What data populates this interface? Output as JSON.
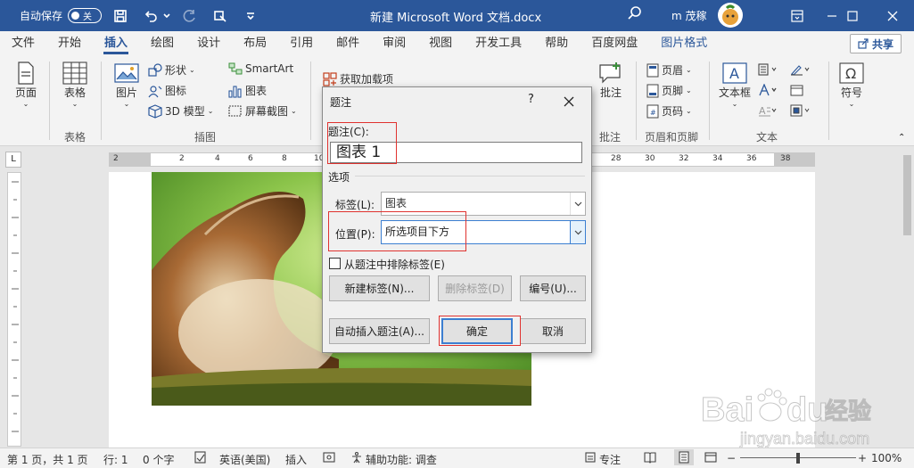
{
  "titlebar": {
    "autosave_label": "自动保存",
    "autosave_state": "关",
    "doc_title": "新建 Microsoft Word 文档.docx",
    "user_name": "m 茂稼"
  },
  "tabs": [
    "文件",
    "开始",
    "插入",
    "绘图",
    "设计",
    "布局",
    "引用",
    "邮件",
    "审阅",
    "视图",
    "开发工具",
    "帮助",
    "百度网盘",
    "图片格式"
  ],
  "share_label": "共享",
  "ribbon": {
    "page": "页面",
    "table": "表格",
    "table_group": "表格",
    "picture": "图片",
    "shapes": "形状",
    "icons": "图标",
    "model3d": "3D 模型",
    "smartart": "SmartArt",
    "chart": "图表",
    "screenshot": "屏幕截图",
    "illustrations_group": "插图",
    "addins": "获取加载项",
    "comment": "批注",
    "comment_group": "批注",
    "header": "页眉",
    "footer": "页脚",
    "page_number": "页码",
    "header_footer_group": "页眉和页脚",
    "textbox": "文本框",
    "text_group": "文本",
    "symbol": "符号"
  },
  "ruler": {
    "h_numbers": [
      "2",
      "2",
      "4",
      "6",
      "8",
      "10",
      "28",
      "30",
      "32",
      "34",
      "36",
      "38"
    ]
  },
  "dialog": {
    "title": "题注",
    "help": "?",
    "caption_label": "题注(C):",
    "caption_value": "图表 1",
    "options_label": "选项",
    "label_label": "标签(L):",
    "label_value": "图表",
    "position_label": "位置(P):",
    "position_value": "所选项目下方",
    "exclude_label": "从题注中排除标签(E)",
    "new_label_btn": "新建标签(N)...",
    "delete_label_btn": "删除标签(D)",
    "numbering_btn": "编号(U)...",
    "autocaption_btn": "自动插入题注(A)...",
    "ok_btn": "确定",
    "cancel_btn": "取消"
  },
  "status": {
    "page": "第 1 页，共 1 页",
    "line": "行: 1",
    "words": "0 个字",
    "language": "英语(美国)",
    "mode": "插入",
    "accessibility": "辅助功能: 调查",
    "focus": "专注",
    "zoom": "100%"
  },
  "watermark": {
    "brand": "Bai",
    "brand2": "du",
    "brand_cn": "经验",
    "url": "jingyan.baidu.com"
  },
  "colors": {
    "word_blue": "#2b579a",
    "highlight_red": "#e0322f"
  }
}
